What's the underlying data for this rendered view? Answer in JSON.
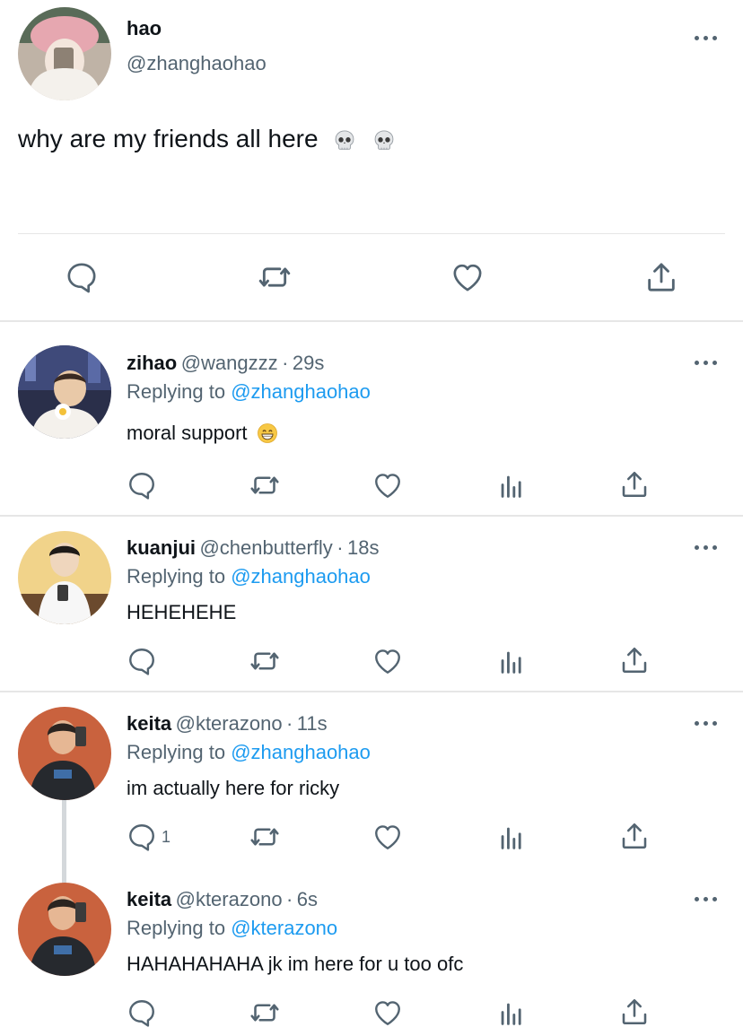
{
  "main_tweet": {
    "name": "hao",
    "handle": "@zhanghaohao",
    "text": "why are my friends all here",
    "emojis": [
      "skull-emoji",
      "skull-emoji"
    ]
  },
  "replies": [
    {
      "name": "zihao",
      "handle": "@wangzzz",
      "sep": "·",
      "time": "29s",
      "replying_label": "Replying to",
      "replying_to": "@zhanghaohao",
      "text": "moral support",
      "emoji": "grinning-face-emoji",
      "reply_count": ""
    },
    {
      "name": "kuanjui",
      "handle": "@chenbutterfly",
      "sep": "·",
      "time": "18s",
      "replying_label": "Replying to",
      "replying_to": "@zhanghaohao",
      "text": "HEHEHEHE",
      "reply_count": ""
    },
    {
      "name": "keita",
      "handle": "@kterazono",
      "sep": "·",
      "time": "11s",
      "replying_label": "Replying to",
      "replying_to": "@zhanghaohao",
      "text": "im actually here for ricky",
      "reply_count": "1"
    },
    {
      "name": "keita",
      "handle": "@kterazono",
      "sep": "·",
      "time": "6s",
      "replying_label": "Replying to",
      "replying_to": "@kterazono",
      "text": "HAHAHAHAHA jk im here for u too ofc",
      "reply_count": ""
    }
  ],
  "icons": {
    "reply": "reply-icon",
    "retweet": "retweet-icon",
    "like": "heart-icon",
    "analytics": "analytics-icon",
    "share": "share-icon",
    "more": "more-icon"
  },
  "colors": {
    "link": "#1d9bf0",
    "secondary": "#536471",
    "divider": "#e6e6e6"
  }
}
